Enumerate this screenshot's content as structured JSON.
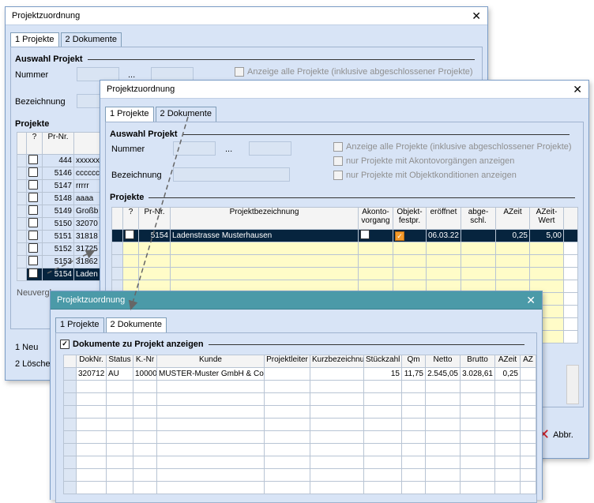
{
  "win_a": {
    "title": "Projektzuordnung",
    "tabs": [
      "1 Projekte",
      "2 Dokumente"
    ],
    "section_auswahl": "Auswahl Projekt",
    "label_nummer": "Nummer",
    "ellipsis": "...",
    "label_bezeichnung": "Bezeichnung",
    "check_alle": "Anzeige alle Projekte (inklusive abgeschlossener Projekte)",
    "section_projekte": "Projekte",
    "rows": [
      {
        "nr": "444",
        "name": "xxxxxxx"
      },
      {
        "nr": "5146",
        "name": "cccccc"
      },
      {
        "nr": "5147",
        "name": "rrrrr"
      },
      {
        "nr": "5148",
        "name": "aaaa"
      },
      {
        "nr": "5149",
        "name": "Großb"
      },
      {
        "nr": "5150",
        "name": "32070"
      },
      {
        "nr": "5151",
        "name": "31818"
      },
      {
        "nr": "5152",
        "name": "31725"
      },
      {
        "nr": "5153",
        "name": "31862"
      },
      {
        "nr": "5154",
        "name": "Laden"
      }
    ],
    "col_q": "?",
    "col_nr": "Pr-Nr.",
    "neuvergl": "Neuvergl",
    "btn_neu": "1 Neu",
    "btn_loeschen": "2 Löschen"
  },
  "win_b": {
    "title": "Projektzuordnung",
    "tabs": [
      "1 Projekte",
      "2 Dokumente"
    ],
    "section_auswahl": "Auswahl Projekt",
    "label_nummer": "Nummer",
    "ellipsis": "...",
    "label_bezeichnung": "Bezeichnung",
    "check_alle": "Anzeige alle Projekte (inklusive abgeschlossener Projekte)",
    "check_akonto": "nur Projekte mit Akontovorgängen anzeigen",
    "check_objekt": "nur Projekte mit Objektkonditionen anzeigen",
    "section_projekte": "Projekte",
    "columns": [
      "?",
      "Pr-Nr.",
      "Projektbezeichnung",
      "Akonto-vorgang",
      "Objekt-festpr.",
      "eröffnet",
      "abge-schl.",
      "AZeit",
      "AZeit-Wert"
    ],
    "selected_row": {
      "nr": "5154",
      "name": "Ladenstrasse Musterhausen",
      "eroeffnet": "06.03.22",
      "azeit": "0,25",
      "azeit_wert": "5,00"
    },
    "btn_abbr": "Abbr."
  },
  "win_c": {
    "title": "Projektzuordnung",
    "tabs": [
      "1 Projekte",
      "2 Dokumente"
    ],
    "section_docs": "Dokumente zu Projekt anzeigen",
    "columns": [
      "DokNr.",
      "Status",
      "K.-Nr",
      "Kunde",
      "Projektleiter",
      "Kurzbezeichnung",
      "Stückzahl",
      "Qm",
      "Netto",
      "Brutto",
      "AZeit",
      "AZ"
    ],
    "row": {
      "doknr": "320712",
      "status": "AU",
      "knr": "10000",
      "kunde": "MUSTER-Muster GmbH & Co",
      "projektleiter": "",
      "kurz": "",
      "stueck": "15",
      "qm": "11,75",
      "netto": "2.545,05",
      "brutto": "3.028,61",
      "azeit": "0,25",
      "az": ""
    }
  }
}
